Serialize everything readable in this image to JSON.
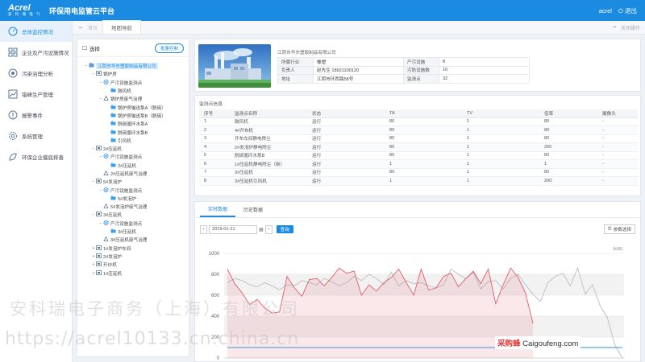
{
  "header": {
    "logo": "Acrel",
    "logo_sub": "安 科 瑞 电 气",
    "title": "环保用电监管云平台",
    "user": "acrel",
    "logout": "退出"
  },
  "sidebar": {
    "items": [
      {
        "label": "总体监控情况"
      },
      {
        "label": "企业及产污设施情况"
      },
      {
        "label": "污染治理分析"
      },
      {
        "label": "错峰生产管理"
      },
      {
        "label": "报警事件"
      },
      {
        "label": "系统管理"
      },
      {
        "label": "环保企业摸底排查"
      }
    ]
  },
  "breadcrumb": {
    "home": "首页",
    "tab": "地图导航",
    "right_label": "关闭操作"
  },
  "tree": {
    "title": "选择",
    "batch_button": "批量控制",
    "nodes": [
      {
        "label": "江阴市华东塑胶制品有限公司"
      },
      {
        "label": "锅炉房"
      },
      {
        "label": "产污设施监测点"
      },
      {
        "label": "鼓风机"
      },
      {
        "label": "锅炉房废气治理"
      },
      {
        "label": "锅炉房输送泵A（脱硫）"
      },
      {
        "label": "锅炉房输送泵B（脱硫）"
      },
      {
        "label": "脱硫循环水泵A"
      },
      {
        "label": "脱硫循环水泵B"
      },
      {
        "label": "引风机"
      },
      {
        "label": "2#压延机"
      },
      {
        "label": "产污设施监测点"
      },
      {
        "label": "2#压延机"
      },
      {
        "label": "2#压延机废气治理"
      },
      {
        "label": "5#发泡炉"
      },
      {
        "label": "产污设施监测点"
      },
      {
        "label": "5#发泡炉"
      },
      {
        "label": "5#发泡炉废气治理"
      },
      {
        "label": "3#压延机"
      },
      {
        "label": "产污设施监测点"
      },
      {
        "label": "3#压延机"
      },
      {
        "label": "3#压延机废气治理"
      },
      {
        "label": "1#发泡炉车间"
      },
      {
        "label": "2#发泡炉"
      },
      {
        "label": "开炒机"
      },
      {
        "label": "1#压延机"
      }
    ]
  },
  "company": {
    "name": "江阴市华东塑胶制品有限公司",
    "rows": [
      {
        "k1": "所属行业",
        "v1": "橡塑",
        "k2": "产污设施",
        "v2": "8"
      },
      {
        "k1": "负责人",
        "v1": "赵先生  18921100120",
        "k2": "污防设施数",
        "v2": "10"
      },
      {
        "k1": "地址",
        "v1": "江阴市环西路58号",
        "k2": "监测点",
        "v2": "32"
      }
    ]
  },
  "monitor": {
    "title": "监测点信息",
    "columns": [
      "序号",
      "监测点名称",
      "状态",
      "TA",
      "TV",
      "倍率",
      "摄像头"
    ],
    "rows": [
      [
        "1",
        "鼓风机",
        "运行",
        "80",
        "1",
        "80",
        "-"
      ],
      [
        "2",
        "4#开布机",
        "运行",
        "80",
        "1",
        "80",
        "-"
      ],
      [
        "3",
        "开布车间静电除尘",
        "运行",
        "80",
        "1",
        "80",
        "-"
      ],
      [
        "4",
        "2#发泡炉静电除尘",
        "运行",
        "80",
        "1",
        "200",
        "-"
      ],
      [
        "5",
        "脱硫循环水泵B",
        "运行",
        "80",
        "1",
        "80",
        "-"
      ],
      [
        "6",
        "1#压延机静电除尘（新）",
        "运行",
        "1",
        "1",
        "1",
        "-"
      ],
      [
        "7",
        "3#压延机",
        "运行",
        "80",
        "1",
        "80",
        "-"
      ],
      [
        "8",
        "3#压延机引风机",
        "运行",
        "1",
        "1",
        "200",
        "-"
      ]
    ]
  },
  "chart": {
    "tabs": [
      "实时数据",
      "历史数据"
    ],
    "date": "2019-01-21",
    "query": "查询",
    "params": "参数选择"
  },
  "chart_data": {
    "type": "line",
    "ylabel": "(kW)",
    "ylim": [
      0,
      1000
    ],
    "yticks": [
      1000,
      800,
      600,
      400,
      200,
      0
    ],
    "grid": true,
    "series": [
      {
        "color": "#e35d6a",
        "area": true,
        "values": [
          850,
          710,
          620,
          510,
          560,
          480,
          430,
          440,
          780,
          670,
          590,
          750,
          760,
          690,
          770,
          860,
          810,
          830,
          600,
          700,
          640,
          720,
          770,
          850,
          720,
          600,
          850,
          650,
          670,
          780,
          810,
          680,
          760,
          830,
          710,
          850,
          520,
          700,
          860,
          770,
          620,
          330
        ]
      },
      {
        "color": "#b9bec6",
        "area": false,
        "values": [
          720,
          760,
          740,
          700,
          680,
          720,
          690,
          650,
          700,
          690,
          740,
          720,
          700,
          760,
          730,
          690,
          720,
          780,
          740,
          800,
          760,
          700,
          820,
          690,
          740,
          710,
          720,
          690,
          670,
          700,
          850,
          800,
          760,
          820,
          660,
          730,
          740,
          660,
          760,
          800,
          700,
          610,
          540,
          720,
          780,
          810,
          690,
          860,
          610,
          700,
          500,
          380,
          120,
          0
        ]
      },
      {
        "color": "#3b8fe0",
        "area": false,
        "values": [
          100,
          100,
          100,
          100,
          100,
          100,
          100,
          100,
          100,
          100,
          100,
          100,
          100,
          100,
          100,
          100,
          100,
          100,
          100,
          100,
          100,
          100,
          100,
          100,
          100,
          100,
          100,
          100,
          100,
          100,
          100,
          100,
          100,
          100,
          100,
          100,
          100,
          100,
          100,
          100,
          100,
          100,
          100,
          100,
          100,
          100,
          100,
          100,
          100,
          100,
          100,
          100,
          100,
          100
        ]
      }
    ]
  },
  "watermark": {
    "line1": "安科瑞电子商务（上海）有限公司",
    "line2": "https://acrel10133.cn.china.cn",
    "brand_cn": "采购蜂",
    "brand_en": "Caigoufeng.com"
  }
}
